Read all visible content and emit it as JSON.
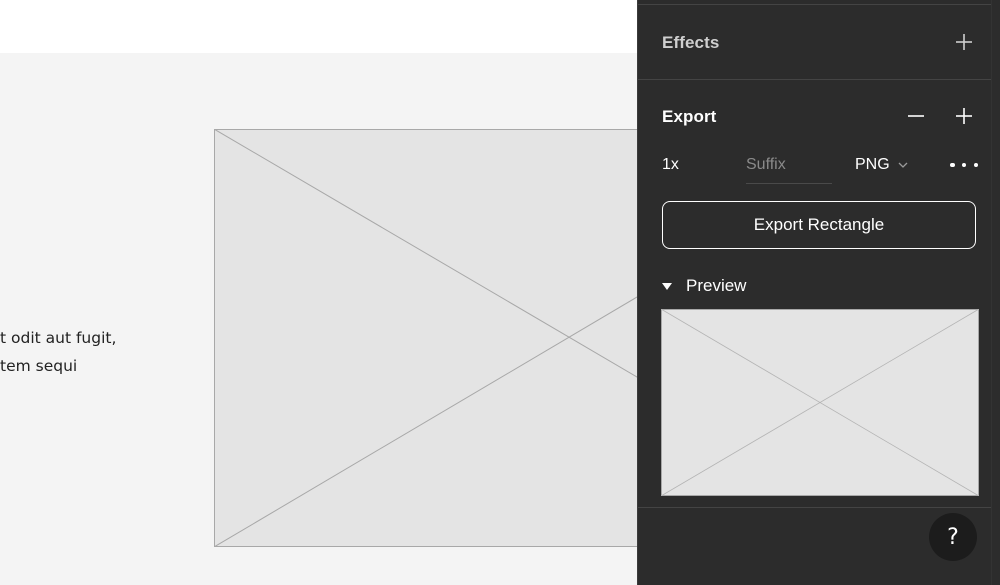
{
  "canvas": {
    "body_text_lines": [
      "t odit aut fugit,",
      "tem sequi"
    ]
  },
  "panel": {
    "effects": {
      "title": "Effects",
      "add_icon": "plus-icon"
    },
    "export": {
      "title": "Export",
      "remove_icon": "minus-icon",
      "add_icon": "plus-icon",
      "scale": "1x",
      "suffix_placeholder": "Suffix",
      "suffix_value": "",
      "format": "PNG",
      "more_icon": "more-horizontal-icon",
      "button_label": "Export Rectangle"
    },
    "preview": {
      "label": "Preview",
      "toggle_icon": "triangle-down-icon",
      "expanded": true
    },
    "help": {
      "label": "?"
    }
  },
  "colors": {
    "panel_bg": "#2c2c2c",
    "canvas_bg": "#f4f4f4",
    "placeholder_fill": "#e4e4e4",
    "placeholder_stroke": "#a8a8a8",
    "text_white": "#ffffff",
    "muted": "#8a8a8a"
  }
}
